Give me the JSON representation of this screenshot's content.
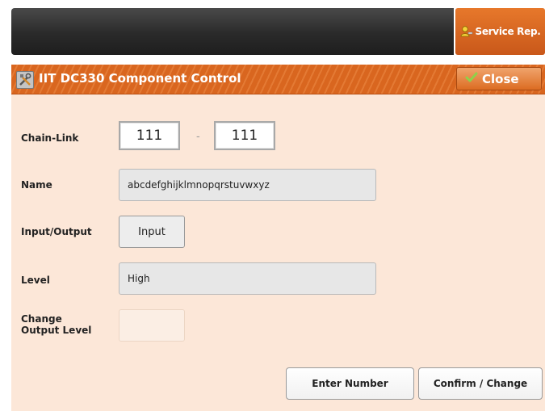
{
  "header": {
    "service_label": "Service Rep.",
    "service_icon": "service-rep-icon"
  },
  "dialog": {
    "title": "IIT DC330 Component Control",
    "title_icon": "tools-icon",
    "close_label": "Close",
    "close_icon": "checkmark-icon"
  },
  "form": {
    "chain_link_label": "Chain-Link",
    "chain_value": "111",
    "separator": "-",
    "link_value": "111",
    "name_label": "Name",
    "name_value": "abcdefghijklmnopqrstuvwxyz",
    "io_label": "Input/Output",
    "io_value": "Input",
    "level_label": "Level",
    "level_value": "High",
    "change_label_line1": "Change",
    "change_label_line2": "Output Level"
  },
  "actions": {
    "enter_number": "Enter Number",
    "confirm_change": "Confirm / Change"
  },
  "colors": {
    "accent": "#d9661f",
    "dialog_bg": "#fce7d8",
    "topbar": "#2a2a2a"
  }
}
